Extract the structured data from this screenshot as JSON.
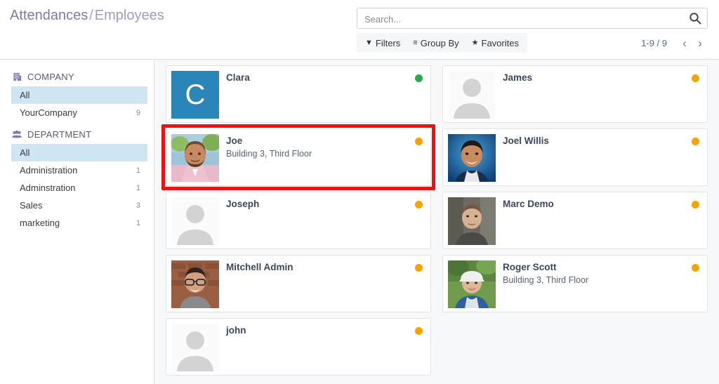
{
  "breadcrumb": {
    "parent": "Attendances",
    "separator": "/",
    "current": "Employees"
  },
  "search": {
    "placeholder": "Search...",
    "value": "",
    "icon": "search-icon"
  },
  "facets": [
    {
      "label": "Filters",
      "icon": "filter-icon",
      "glyph": "▼"
    },
    {
      "label": "Group By",
      "icon": "group-by-icon",
      "glyph": "≡"
    },
    {
      "label": "Favorites",
      "icon": "star-icon",
      "glyph": "★"
    }
  ],
  "pager": {
    "count": "1-9 / 9",
    "prev_icon": "chevron-left-icon",
    "prev_glyph": "‹",
    "next_icon": "chevron-right-icon",
    "next_glyph": "›"
  },
  "sidebar": {
    "sections": [
      {
        "title": "COMPANY",
        "icon": "building-icon",
        "items": [
          {
            "label": "All",
            "count": "",
            "selected": true
          },
          {
            "label": "YourCompany",
            "count": "9",
            "selected": false
          }
        ]
      },
      {
        "title": "DEPARTMENT",
        "icon": "users-icon",
        "items": [
          {
            "label": "All",
            "count": "",
            "selected": true
          },
          {
            "label": "Administration",
            "count": "1",
            "selected": false
          },
          {
            "label": "Adminstration",
            "count": "1",
            "selected": false
          },
          {
            "label": "Sales",
            "count": "3",
            "selected": false
          },
          {
            "label": "marketing",
            "count": "1",
            "selected": false
          }
        ]
      }
    ]
  },
  "colors": {
    "status_green": "#2aa84a",
    "status_orange": "#f5a302",
    "avatar_blue": "#2a85b8",
    "highlight_red": "#ee1111",
    "selected_row": "#cfe7f5",
    "accent_purple": "#7c7bad"
  },
  "kanban": {
    "columns": [
      {
        "cards": [
          {
            "name": "Clara",
            "job": "",
            "status": "green",
            "avatar": "initial",
            "initial": "C",
            "highlighted": false
          },
          {
            "name": "Joe",
            "job": "Building 3, Third Floor",
            "status": "orange",
            "avatar": "photo-joe",
            "initial": "",
            "highlighted": true
          },
          {
            "name": "Joseph",
            "job": "",
            "status": "orange",
            "avatar": "placeholder",
            "initial": "",
            "highlighted": false
          },
          {
            "name": "Mitchell Admin",
            "job": "",
            "status": "orange",
            "avatar": "photo-mitchell",
            "initial": "",
            "highlighted": false
          },
          {
            "name": "john",
            "job": "",
            "status": "orange",
            "avatar": "placeholder",
            "initial": "",
            "highlighted": false
          }
        ]
      },
      {
        "cards": [
          {
            "name": "James",
            "job": "",
            "status": "orange",
            "avatar": "placeholder",
            "initial": "",
            "highlighted": false
          },
          {
            "name": "Joel Willis",
            "job": "",
            "status": "orange",
            "avatar": "photo-joel",
            "initial": "",
            "highlighted": false
          },
          {
            "name": "Marc Demo",
            "job": "",
            "status": "orange",
            "avatar": "photo-marc",
            "initial": "",
            "highlighted": false
          },
          {
            "name": "Roger Scott",
            "job": "Building 3, Third Floor",
            "status": "orange",
            "avatar": "photo-roger",
            "initial": "",
            "highlighted": false
          }
        ]
      }
    ]
  }
}
